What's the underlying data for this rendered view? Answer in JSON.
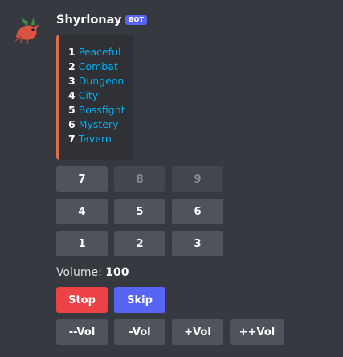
{
  "message": {
    "username": "Shyrlonay",
    "bot_tag": "BOT",
    "avatar_icon": "dragon-icon",
    "accent_color": "#e06c4a"
  },
  "embed": {
    "items": [
      {
        "num": "1",
        "label": "Peaceful"
      },
      {
        "num": "2",
        "label": "Combat"
      },
      {
        "num": "3",
        "label": "Dungeon"
      },
      {
        "num": "4",
        "label": "City"
      },
      {
        "num": "5",
        "label": "Bossfight"
      },
      {
        "num": "6",
        "label": "Mystery"
      },
      {
        "num": "7",
        "label": "Tavern"
      }
    ]
  },
  "keypad": {
    "row1": [
      "7",
      "8",
      "9"
    ],
    "row2": [
      "4",
      "5",
      "6"
    ],
    "row3": [
      "1",
      "2",
      "3"
    ]
  },
  "volume": {
    "label": "Volume:",
    "value": "100"
  },
  "controls": {
    "stop": "Stop",
    "skip": "Skip"
  },
  "vol_buttons": [
    "--Vol",
    "-Vol",
    "+Vol",
    "++Vol"
  ]
}
